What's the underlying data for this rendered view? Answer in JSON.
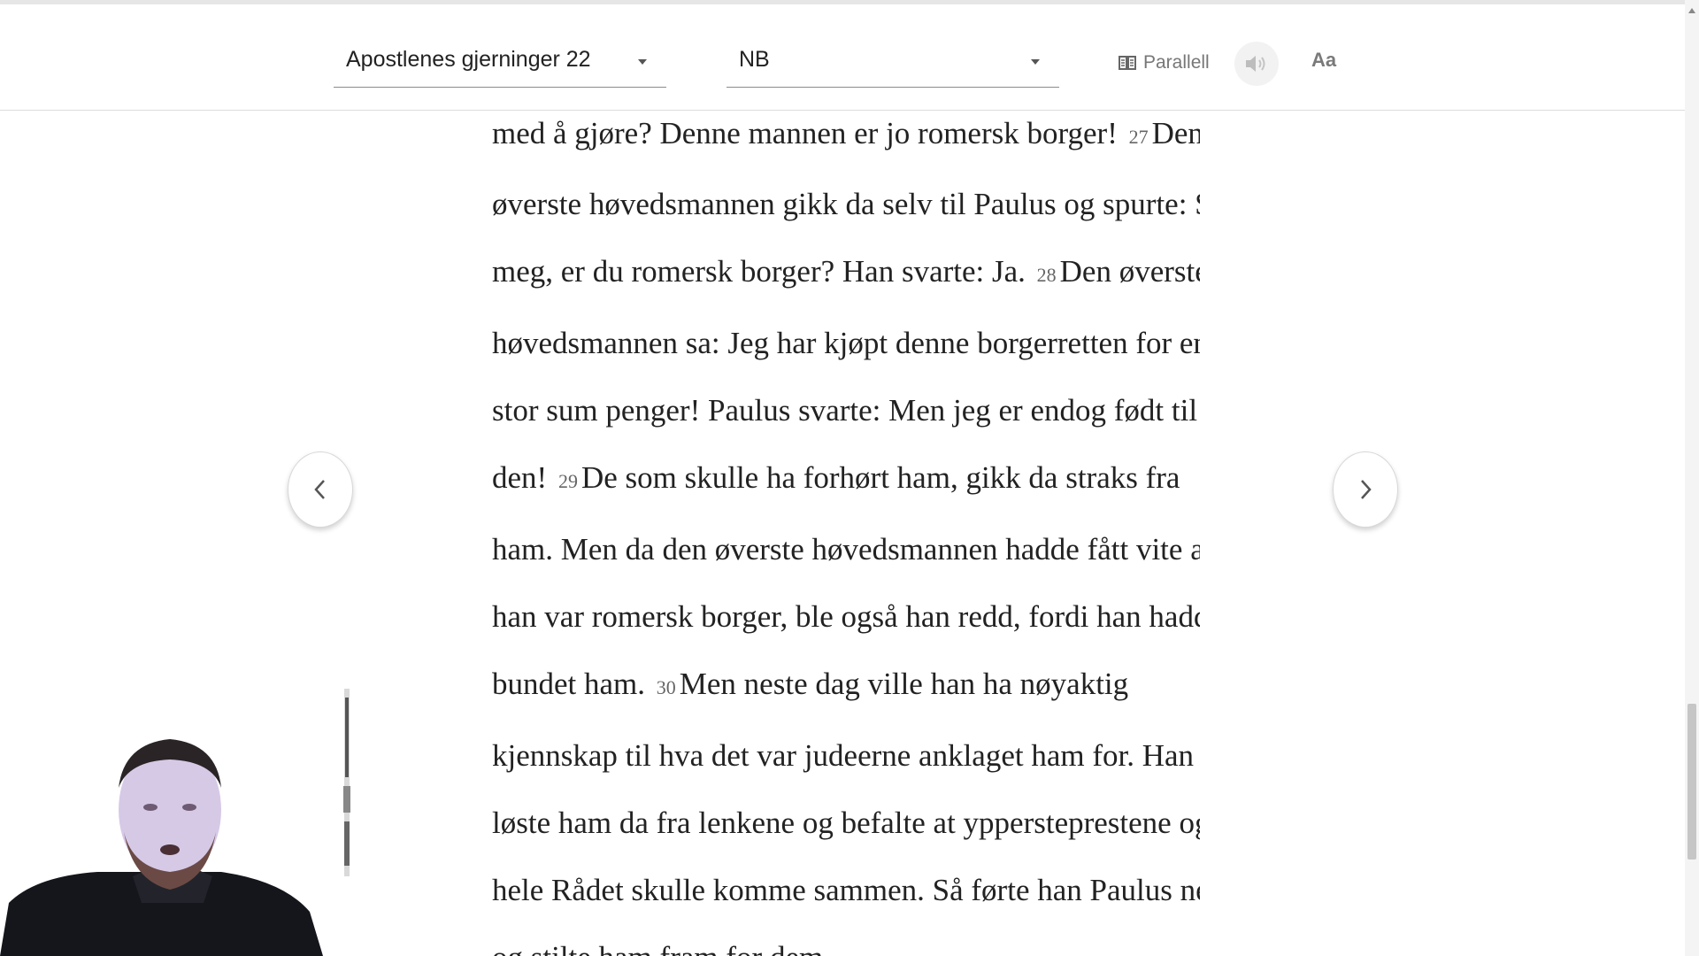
{
  "header": {
    "book_chapter": "Apostlenes gjerninger 22",
    "version": "NB",
    "parallel_label": "Parallell",
    "font_button_label": "Aa",
    "icons": {
      "parallel": "book-columns-icon",
      "audio": "speaker-icon"
    }
  },
  "content": {
    "lines": [
      [
        {
          "t": "med å gjøre? Denne mannen er jo romersk borger! "
        },
        {
          "n": "27"
        },
        {
          "t": "Den"
        }
      ],
      [
        {
          "t": "øverste høvedsmannen gikk da selv til Paulus og spurte: Si"
        }
      ],
      [
        {
          "t": "meg, er du romersk borger? Han svarte: Ja. "
        },
        {
          "n": "28"
        },
        {
          "t": "Den øverste"
        }
      ],
      [
        {
          "t": "høvedsmannen sa: Jeg har kjøpt denne borgerretten for en"
        }
      ],
      [
        {
          "t": "stor sum penger! Paulus svarte: Men jeg er endog født til"
        }
      ],
      [
        {
          "t": "den! "
        },
        {
          "n": "29"
        },
        {
          "t": "De som skulle ha forhørt ham, gikk da straks fra"
        }
      ],
      [
        {
          "t": "ham. Men da den øverste høvedsmannen hadde fått vite at"
        }
      ],
      [
        {
          "t": "han var romersk borger, ble også han redd, fordi han hadde"
        }
      ],
      [
        {
          "t": "bundet ham. "
        },
        {
          "n": "30"
        },
        {
          "t": "Men neste dag ville han ha nøyaktig"
        }
      ],
      [
        {
          "t": "kjennskap til hva det var judeerne anklaget ham for. Han"
        }
      ],
      [
        {
          "t": "løste ham da fra lenkene og befalte at yppersteprestene og"
        }
      ],
      [
        {
          "t": "hele Rådet skulle komme sammen. Så førte han Paulus ned"
        }
      ],
      [
        {
          "t": "og stilte ham fram for dem."
        }
      ]
    ]
  },
  "navigation": {
    "prev_icon": "chevron-left-icon",
    "next_icon": "chevron-right-icon"
  },
  "colors": {
    "text": "#222222",
    "verse_number": "#666666",
    "muted": "#777777",
    "divider": "#dcdcdc"
  }
}
